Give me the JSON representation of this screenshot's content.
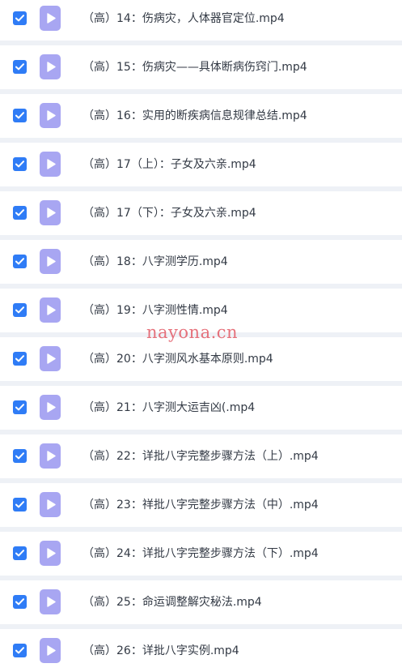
{
  "files": [
    {
      "name": "（高）14：伤病灾，人体器官定位.mp4",
      "checked": true
    },
    {
      "name": "（高）15：伤病灾——具体断病伤窍门.mp4",
      "checked": true
    },
    {
      "name": "（高）16：实用的断疾病信息规律总结.mp4",
      "checked": true
    },
    {
      "name": "（高）17（上）：子女及六亲.mp4",
      "checked": true
    },
    {
      "name": "（高）17（下）：子女及六亲.mp4",
      "checked": true
    },
    {
      "name": "（高）18：八字测学历.mp4",
      "checked": true
    },
    {
      "name": "（高）19：八字测性情.mp4",
      "checked": true
    },
    {
      "name": "（高）20：八字测风水基本原则.mp4",
      "checked": true
    },
    {
      "name": "（高）21：八字测大运吉凶(.mp4",
      "checked": true
    },
    {
      "name": "（高）22：详批八字完整步骤方法（上）.mp4",
      "checked": true
    },
    {
      "name": "（高）23：祥批八字完整步骤方法（中）.mp4",
      "checked": true
    },
    {
      "name": "（高）24：详批八字完整步骤方法（下）.mp4",
      "checked": true
    },
    {
      "name": "（高）25：命运调整解灾秘法.mp4",
      "checked": true
    },
    {
      "name": "（高）26：详批八字实例.mp4",
      "checked": true
    }
  ],
  "watermark": "nayona.cn",
  "icons": {
    "checkbox": "checkbox-checked-icon",
    "file": "video-file-icon"
  },
  "colors": {
    "checkbox": "#2f7cf6",
    "file_icon": "#a8a6f2",
    "row_bg": "#ffffff",
    "page_bg": "#eef1f6",
    "text": "#333a45",
    "watermark": "#e4636e"
  }
}
